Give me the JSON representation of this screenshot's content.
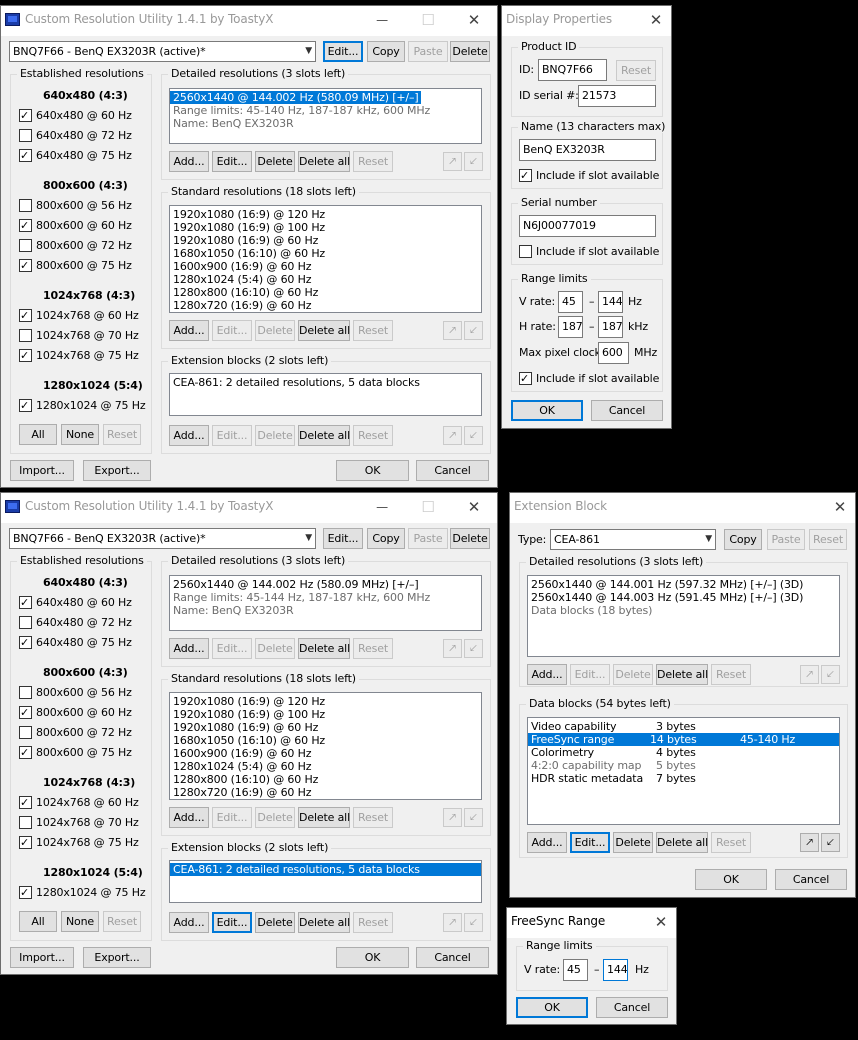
{
  "cru": {
    "title": "Custom Resolution Utility 1.4.1 by ToastyX",
    "monitor": "BNQ7F66 - BenQ EX3203R (active)*",
    "top_buttons": {
      "edit": "Edit...",
      "copy": "Copy",
      "paste": "Paste",
      "delete": "Delete"
    },
    "established": {
      "title": "Established resolutions",
      "groups": [
        {
          "header": "640x480 (4:3)",
          "items": [
            {
              "label": "640x480 @ 60 Hz",
              "checked": true
            },
            {
              "label": "640x480 @ 72 Hz",
              "checked": false
            },
            {
              "label": "640x480 @ 75 Hz",
              "checked": true
            }
          ]
        },
        {
          "header": "800x600 (4:3)",
          "items": [
            {
              "label": "800x600 @ 56 Hz",
              "checked": false
            },
            {
              "label": "800x600 @ 60 Hz",
              "checked": true
            },
            {
              "label": "800x600 @ 72 Hz",
              "checked": false
            },
            {
              "label": "800x600 @ 75 Hz",
              "checked": true
            }
          ]
        },
        {
          "header": "1024x768 (4:3)",
          "items": [
            {
              "label": "1024x768 @ 60 Hz",
              "checked": true
            },
            {
              "label": "1024x768 @ 70 Hz",
              "checked": false
            },
            {
              "label": "1024x768 @ 75 Hz",
              "checked": true
            }
          ]
        },
        {
          "header": "1280x1024 (5:4)",
          "items": [
            {
              "label": "1280x1024 @ 75 Hz",
              "checked": true
            }
          ]
        }
      ],
      "buttons": {
        "all": "All",
        "none": "None",
        "reset": "Reset"
      }
    },
    "detailed": {
      "title": "Detailed resolutions (3 slots left)",
      "win1_lines": [
        "2560x1440 @ 144.002 Hz (580.09 MHz) [+/–]",
        "Range limits: 45-140 Hz, 187-187 kHz, 600 MHz",
        "Name: BenQ EX3203R"
      ],
      "win2_lines": [
        "2560x1440 @ 144.002 Hz (580.09 MHz) [+/–]",
        "Range limits: 45-144 Hz, 187-187 kHz, 600 MHz",
        "Name: BenQ EX3203R"
      ]
    },
    "standard": {
      "title": "Standard resolutions (18 slots left)",
      "lines": [
        "1920x1080 (16:9) @ 120 Hz",
        "1920x1080 (16:9) @ 100 Hz",
        "1920x1080 (16:9) @ 60 Hz",
        "1680x1050 (16:10) @ 60 Hz",
        "1600x900 (16:9) @ 60 Hz",
        "1280x1024 (5:4) @ 60 Hz",
        "1280x800 (16:10) @ 60 Hz",
        "1280x720 (16:9) @ 60 Hz"
      ]
    },
    "extension": {
      "title": "Extension blocks (2 slots left)",
      "lines": [
        "CEA-861: 2 detailed resolutions, 5 data blocks"
      ]
    },
    "section_buttons": {
      "add": "Add...",
      "edit": "Edit...",
      "delete": "Delete",
      "delete_all": "Delete all",
      "reset": "Reset"
    },
    "bottom": {
      "import": "Import...",
      "export": "Export...",
      "ok": "OK",
      "cancel": "Cancel"
    }
  },
  "display_properties": {
    "title": "Display Properties",
    "product_id": {
      "title": "Product ID",
      "id_label": "ID:",
      "id_value": "BNQ7F66",
      "reset": "Reset",
      "serial_label": "ID serial #:",
      "serial_value": "21573"
    },
    "name": {
      "title": "Name (13 characters max)",
      "value": "BenQ EX3203R",
      "include": "Include if slot available",
      "checked": true
    },
    "serial_number": {
      "title": "Serial number",
      "value": "N6J00077019",
      "include": "Include if slot available",
      "checked": false
    },
    "range_limits": {
      "title": "Range limits",
      "v_label": "V rate:",
      "v_min": "45",
      "v_max": "144",
      "v_unit": "Hz",
      "dash": "–",
      "h_label": "H rate:",
      "h_min": "187",
      "h_max": "187",
      "h_unit": "kHz",
      "clock_label": "Max pixel clock:",
      "clock_value": "600",
      "clock_unit": "MHz",
      "include": "Include if slot available",
      "checked": true
    },
    "ok": "OK",
    "cancel": "Cancel"
  },
  "extension_block": {
    "title": "Extension Block",
    "type_label": "Type:",
    "type_value": "CEA-861",
    "buttons": {
      "copy": "Copy",
      "paste": "Paste",
      "reset": "Reset"
    },
    "detailed": {
      "title": "Detailed resolutions (3 slots left)",
      "lines": [
        "2560x1440 @ 144.001 Hz (597.32 MHz) [+/–] (3D)",
        "2560x1440 @ 144.003 Hz (591.45 MHz) [+/–] (3D)",
        "Data blocks (18 bytes)"
      ]
    },
    "data_blocks": {
      "title": "Data blocks (54 bytes left)",
      "rows": [
        {
          "name": "Video capability",
          "size": "3 bytes",
          "info": ""
        },
        {
          "name": "FreeSync range",
          "size": "14 bytes",
          "info": "45-140 Hz"
        },
        {
          "name": "Colorimetry",
          "size": "4 bytes",
          "info": ""
        },
        {
          "name": "4:2:0 capability map",
          "size": "5 bytes",
          "info": ""
        },
        {
          "name": "HDR static metadata",
          "size": "7 bytes",
          "info": ""
        }
      ]
    },
    "ok": "OK",
    "cancel": "Cancel"
  },
  "freesync": {
    "title": "FreeSync Range",
    "group": "Range limits",
    "v_label": "V rate:",
    "v_min": "45",
    "dash": "–",
    "v_max": "144",
    "unit": "Hz",
    "ok": "OK",
    "cancel": "Cancel"
  },
  "icons": {
    "close": "✕",
    "maximize": "☐",
    "minimize": "—",
    "dropdown": "⌄",
    "up": "🡕",
    "down": "🡗"
  },
  "colors": {
    "accent": "#0078d7",
    "window_bg": "#f0f0f0"
  }
}
